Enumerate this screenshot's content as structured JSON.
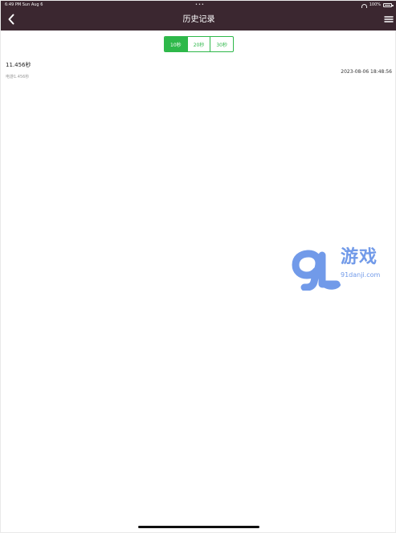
{
  "status_bar": {
    "time_date": "6:49 PM   Sun Aug 6",
    "center_dots": "•••",
    "battery_text": "100%"
  },
  "nav": {
    "title": "历史记录",
    "back_icon": "chevron-left-icon",
    "menu_icon": "menu-icon"
  },
  "tabs": [
    {
      "label": "10秒",
      "active": true
    },
    {
      "label": "20秒",
      "active": false
    },
    {
      "label": "30秒",
      "active": false
    }
  ],
  "records": [
    {
      "time": "11.456秒",
      "detail": "电游1.456秒",
      "timestamp": "2023-08-06 18:48:56"
    }
  ],
  "watermark": {
    "text": "游戏",
    "url": "91danji.com"
  },
  "colors": {
    "nav_bg": "#3b2730",
    "accent_green": "#2eb84a",
    "watermark_blue": "#6a95e8"
  }
}
